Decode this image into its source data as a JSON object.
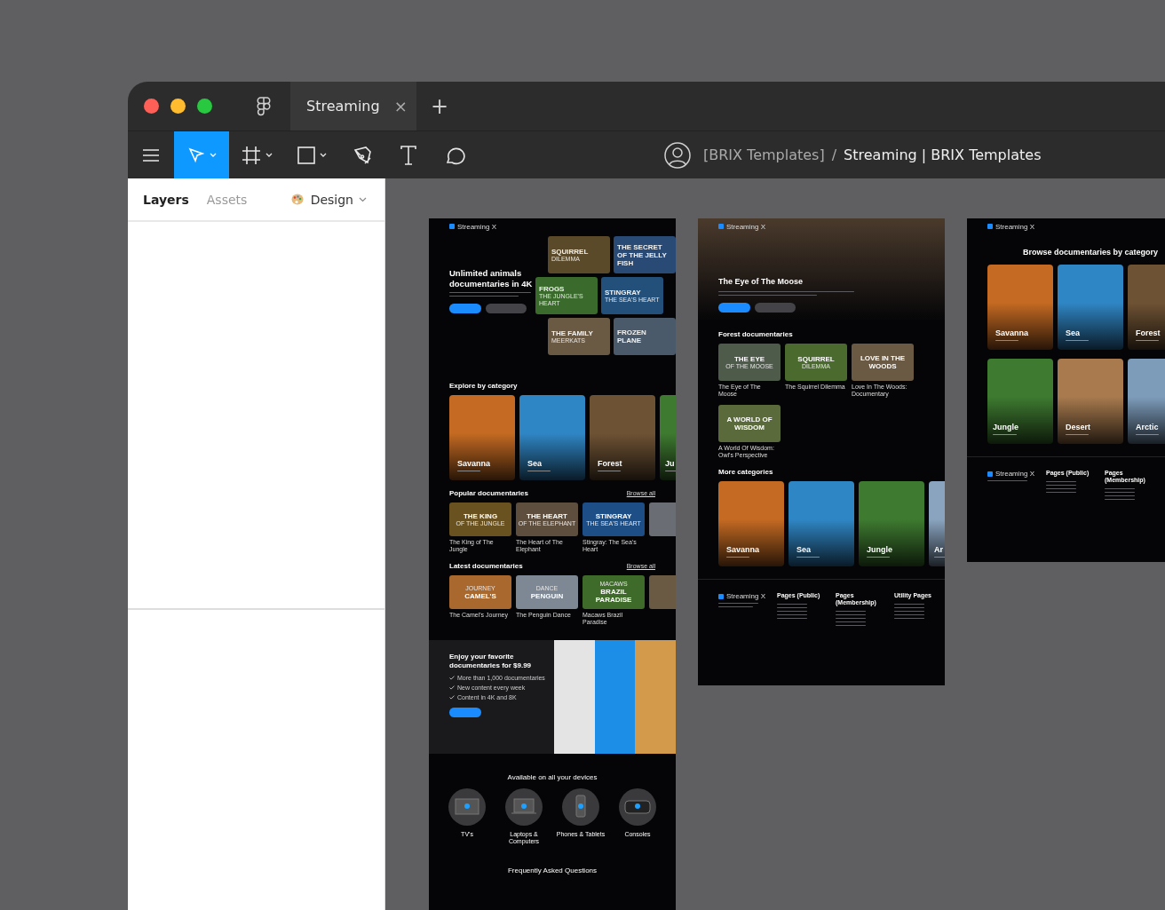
{
  "window": {
    "tabs": [
      {
        "label": "Streaming",
        "selected": true,
        "close": "×"
      }
    ],
    "new_tab": "+",
    "tools": [
      {
        "kind": "menu",
        "selected": false,
        "dropdown": false
      },
      {
        "kind": "move",
        "selected": true,
        "dropdown": true
      },
      {
        "kind": "frame",
        "selected": false,
        "dropdown": true
      },
      {
        "kind": "rectangle",
        "selected": false,
        "dropdown": true
      },
      {
        "kind": "pen",
        "selected": false,
        "dropdown": false
      },
      {
        "kind": "text",
        "selected": false,
        "dropdown": false
      },
      {
        "kind": "comment",
        "selected": false,
        "dropdown": false
      }
    ],
    "breadcrumb": {
      "team": "[BRIX Templates]",
      "separator": "/",
      "file": "Streaming | BRIX Templates"
    }
  },
  "left_panel": {
    "tabs": [
      {
        "label": "Layers",
        "selected": true
      },
      {
        "label": "Assets",
        "selected": false
      }
    ],
    "design_menu": "Design"
  },
  "home_frame": {
    "logo": "Streaming X",
    "hero_title": "Unlimited animals documentaries in 4K",
    "hero_posters": [
      {
        "title": "SQUIRREL",
        "subtitle": "DILEMMA"
      },
      {
        "title": "THE SECRET OF THE JELLY FISH"
      },
      {
        "title": "FROGS",
        "subtitle": "THE JUNGLE'S HEART"
      },
      {
        "title": "STINGRAY",
        "subtitle": "THE SEA'S HEART"
      },
      {
        "title": "THE FAMILY",
        "subtitle": "MEERKATS"
      },
      {
        "title": "FROZEN PLANE"
      }
    ],
    "explore_title": "Explore by category",
    "categories": [
      {
        "name": "Savanna"
      },
      {
        "name": "Sea"
      },
      {
        "name": "Forest"
      },
      {
        "name": "Ju"
      }
    ],
    "popular_title": "Popular documentaries",
    "popular_link": "Browse all",
    "popular": [
      {
        "title": "THE KING",
        "subtitle": "OF THE JUNGLE",
        "caption": "The King of The Jungle"
      },
      {
        "title": "THE HEART",
        "subtitle": "OF THE ELEPHANT",
        "caption": "The Heart of The Elephant"
      },
      {
        "title": "STINGRAY",
        "subtitle": "THE SEA'S HEART",
        "caption": "Stingray: The Sea's Heart"
      }
    ],
    "latest_title": "Latest documentaries",
    "latest_link": "Browse all",
    "latest": [
      {
        "title": "CAMEL'S",
        "subtitle": "JOURNEY",
        "caption": "The Camel's Journey"
      },
      {
        "title": "PENGUIN",
        "subtitle": "DANCE",
        "caption": "The Penguin Dance"
      },
      {
        "title": "BRAZIL PARADISE",
        "subtitle": "MACAWS",
        "caption": "Macaws Brazil Paradise"
      }
    ],
    "promo_title": "Enjoy your favorite documentaries for $9.99",
    "promo_points": [
      "More than 1,000 documentaries",
      "New content every week",
      "Content in 4K and 8K"
    ],
    "devices_title": "Available on all your devices",
    "devices": [
      {
        "kind": "tv",
        "label": "TV's"
      },
      {
        "kind": "laptop",
        "label": "Laptops & Computers"
      },
      {
        "kind": "phone",
        "label": "Phones & Tablets"
      },
      {
        "kind": "console",
        "label": "Consoles"
      }
    ],
    "faq_title": "Frequently Asked Questions"
  },
  "detail_frame": {
    "logo": "Streaming X",
    "hero_title": "The Eye of The Moose",
    "section_title": "Forest documentaries",
    "posters": [
      {
        "title": "THE EYE",
        "subtitle": "OF THE MOOSE",
        "caption": "The Eye of The Moose"
      },
      {
        "title": "SQUIRREL",
        "subtitle": "DILEMMA",
        "caption": "The Squirrel Dilemma"
      },
      {
        "title": "LOVE IN THE WOODS",
        "caption": "Love In The Woods: Documentary"
      },
      {
        "title": "A WORLD OF WISDOM",
        "caption": "A World Of Wisdom: Owl's Perspective"
      }
    ],
    "more_title": "More categories",
    "categories": [
      {
        "name": "Savanna"
      },
      {
        "name": "Sea"
      },
      {
        "name": "Jungle"
      },
      {
        "name": "Ar"
      }
    ],
    "footer_logo": "Streaming X",
    "footer_columns": [
      "Pages (Public)",
      "Pages (Membership)",
      "Utility Pages"
    ]
  },
  "category_frame": {
    "logo": "Streaming X",
    "title": "Browse documentaries by category",
    "categories": [
      {
        "name": "Savanna"
      },
      {
        "name": "Sea"
      },
      {
        "name": "Forest"
      },
      {
        "name": "Jungle"
      },
      {
        "name": "Desert"
      },
      {
        "name": "Arctic"
      }
    ],
    "footer_logo": "Streaming X",
    "footer_columns": [
      "Pages (Public)",
      "Pages (Membership)"
    ]
  }
}
